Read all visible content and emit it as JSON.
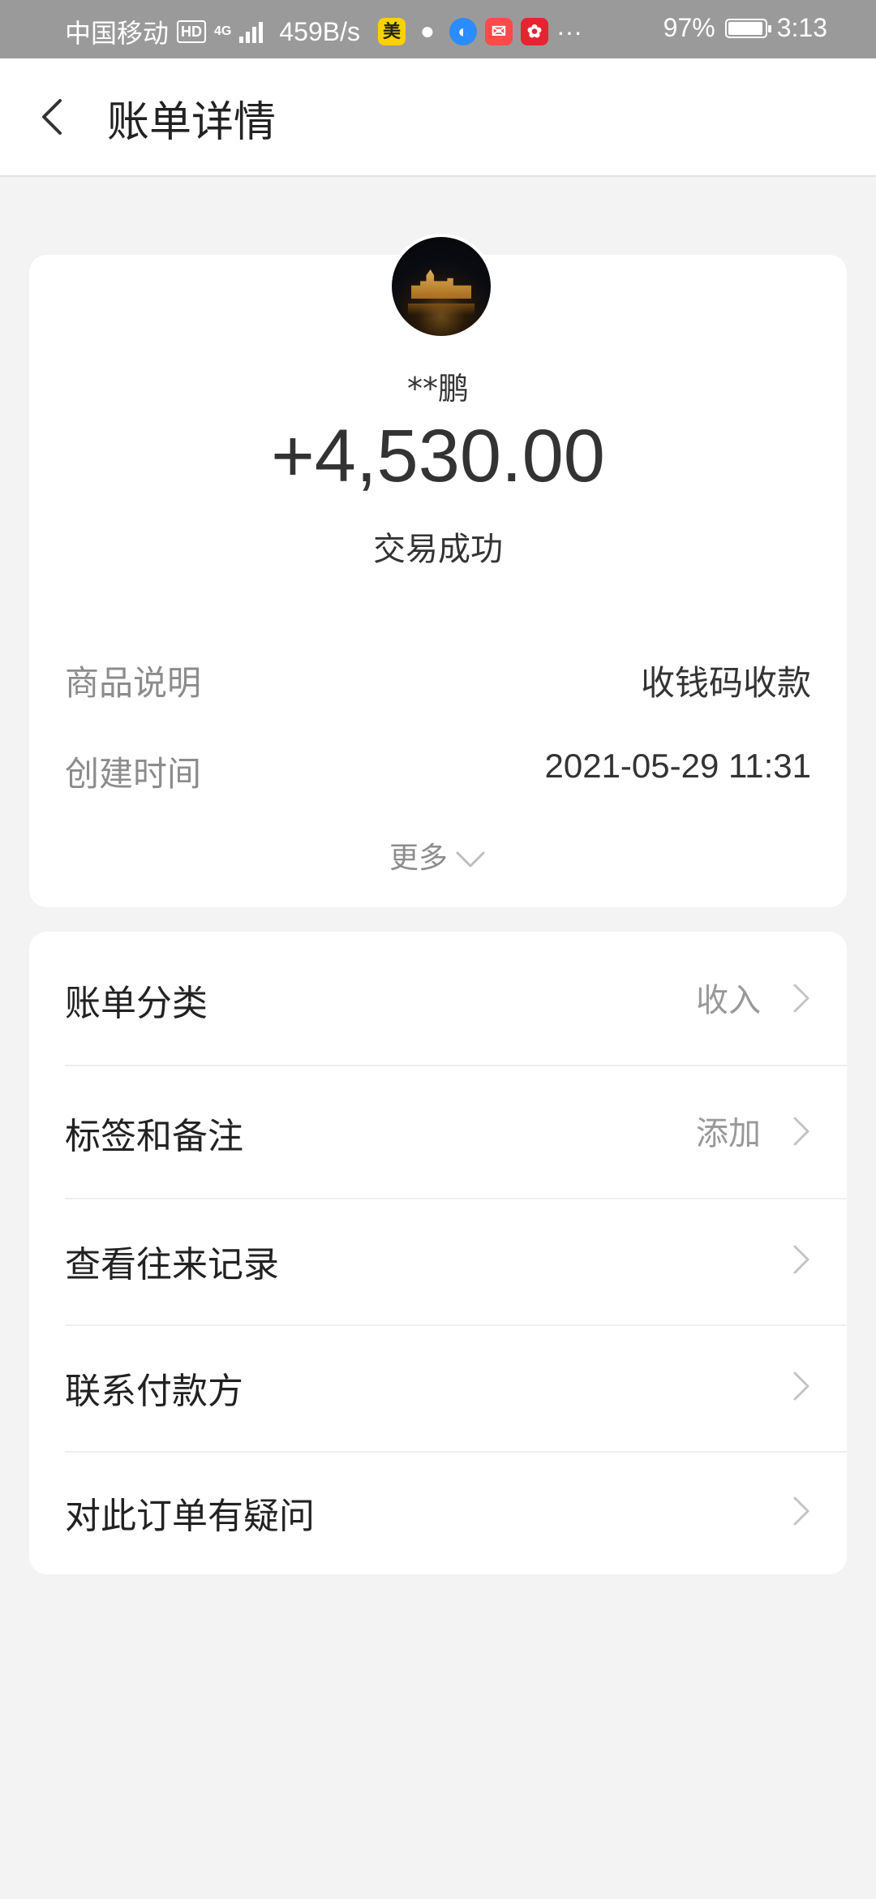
{
  "status_bar": {
    "carrier": "中国移动",
    "hd": "HD",
    "network": "4G",
    "speed": "459B/s",
    "app_mei": "美",
    "more": "···",
    "battery_text": "97%",
    "battery_level": 0.97,
    "time": "3:13"
  },
  "header": {
    "title": "账单详情"
  },
  "summary": {
    "payer_name": "**鹏",
    "amount": "+4,530.00",
    "status": "交易成功",
    "details": [
      {
        "label": "商品说明",
        "value": "收钱码收款"
      },
      {
        "label": "创建时间",
        "value": "2021-05-29 11:31"
      }
    ],
    "more_label": "更多"
  },
  "menu": {
    "items": [
      {
        "label": "账单分类",
        "value": "收入"
      },
      {
        "label": "标签和备注",
        "value": "添加"
      },
      {
        "label": "查看往来记录",
        "value": ""
      },
      {
        "label": "联系付款方",
        "value": ""
      },
      {
        "label": "对此订单有疑问",
        "value": ""
      }
    ]
  },
  "colors": {
    "status_bar_bg": "#9a9a9a",
    "page_bg": "#f3f3f3",
    "card_bg": "#ffffff",
    "secondary_text": "#8c8c8c"
  }
}
